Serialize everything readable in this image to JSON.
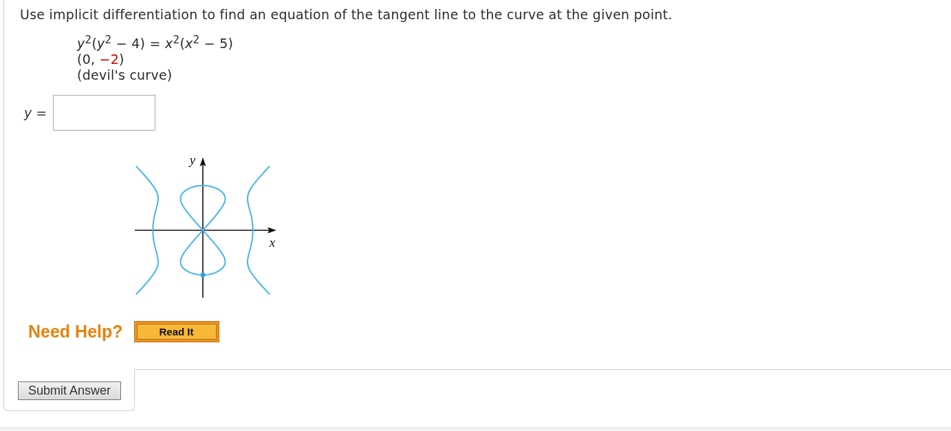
{
  "question": {
    "prompt": "Use implicit differentiation to find an equation of the tangent line to the curve at the given point.",
    "equation": "*y*$^{2}$(*y*$^{2}$ − 4) = *x*$^{2}$(*x*$^{2}$ − 5)",
    "point": [
      {
        "text": "(0, ",
        "highlighted": false
      },
      {
        "text": "−2",
        "highlighted": true
      },
      {
        "text": ")",
        "highlighted": false
      }
    ],
    "note": "(devil's curve)"
  },
  "answer": {
    "label": "*y* ="
  },
  "graph": {
    "x_label": "x",
    "y_label": "y"
  },
  "help": {
    "label": "Need Help?",
    "buttons": [
      "Read It"
    ]
  },
  "submit": {
    "label": "Submit Answer"
  }
}
